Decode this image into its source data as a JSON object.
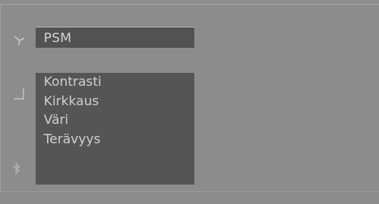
{
  "osd": {
    "title": "PSM",
    "menu_items": [
      {
        "label": "Kontrasti"
      },
      {
        "label": "Kirkkaus"
      },
      {
        "label": "Väri"
      },
      {
        "label": "Terävyys"
      }
    ],
    "icons": [
      "antenna-icon",
      "picture-icon",
      "sound-icon"
    ],
    "colors": {
      "background": "#8c8c8c",
      "panel": "#555555",
      "title_bar": "#525252",
      "text": "#cfcfcf"
    }
  }
}
